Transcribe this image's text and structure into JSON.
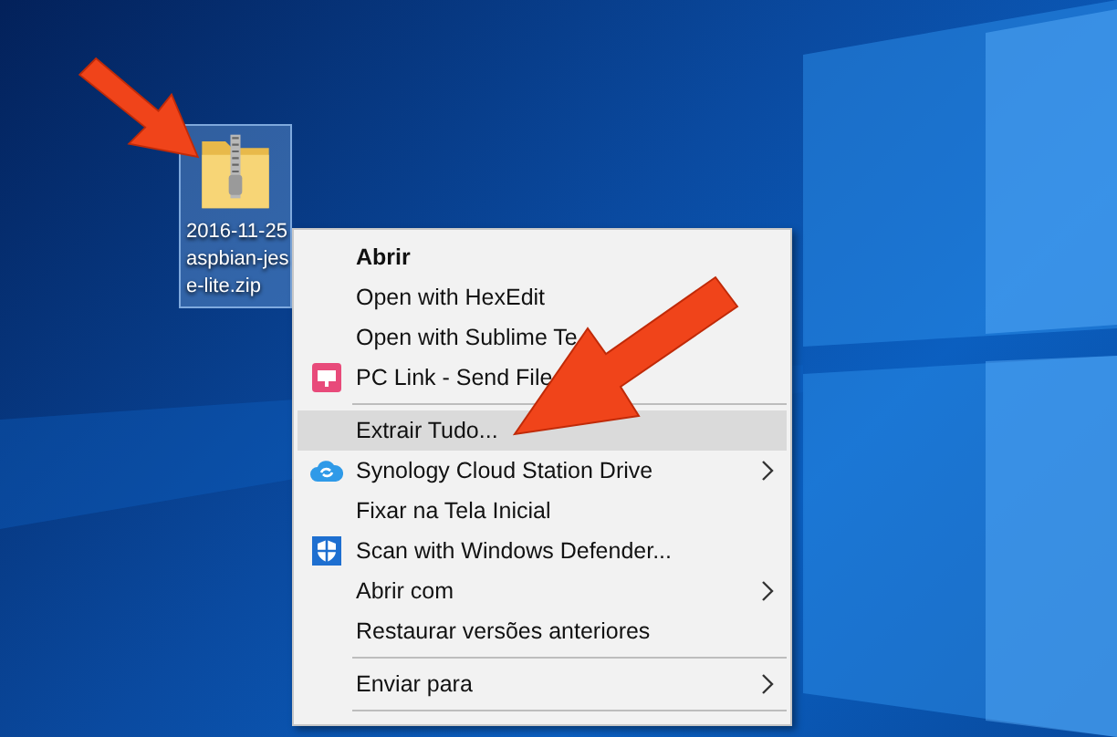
{
  "desktop_icon": {
    "label": "2016-11-25\naspbian-jes\ne-lite.zip",
    "selected": true
  },
  "context_menu": {
    "items": [
      {
        "kind": "item",
        "label": "Abrir",
        "default": true,
        "selected": false,
        "submenu": false
      },
      {
        "kind": "item",
        "label": "Open with HexEdit",
        "default": false,
        "selected": false,
        "submenu": false
      },
      {
        "kind": "item",
        "label": "Open with Sublime Te",
        "default": false,
        "selected": false,
        "submenu": false
      },
      {
        "kind": "pclink",
        "label": "PC Link - Send File",
        "default": false,
        "selected": false,
        "submenu": false
      },
      {
        "kind": "separator"
      },
      {
        "kind": "item",
        "label": "Extrair Tudo...",
        "default": false,
        "selected": true,
        "submenu": false
      },
      {
        "kind": "cloud",
        "label": "Synology Cloud Station Drive",
        "default": false,
        "selected": false,
        "submenu": true
      },
      {
        "kind": "item",
        "label": "Fixar na Tela Inicial",
        "default": false,
        "selected": false,
        "submenu": false
      },
      {
        "kind": "shield",
        "label": "Scan with Windows Defender...",
        "default": false,
        "selected": false,
        "submenu": false
      },
      {
        "kind": "item",
        "label": "Abrir com",
        "default": false,
        "selected": false,
        "submenu": true
      },
      {
        "kind": "item",
        "label": "Restaurar versões anteriores",
        "default": false,
        "selected": false,
        "submenu": false
      },
      {
        "kind": "separator"
      },
      {
        "kind": "item",
        "label": "Enviar para",
        "default": false,
        "selected": false,
        "submenu": true
      },
      {
        "kind": "separator"
      }
    ]
  }
}
